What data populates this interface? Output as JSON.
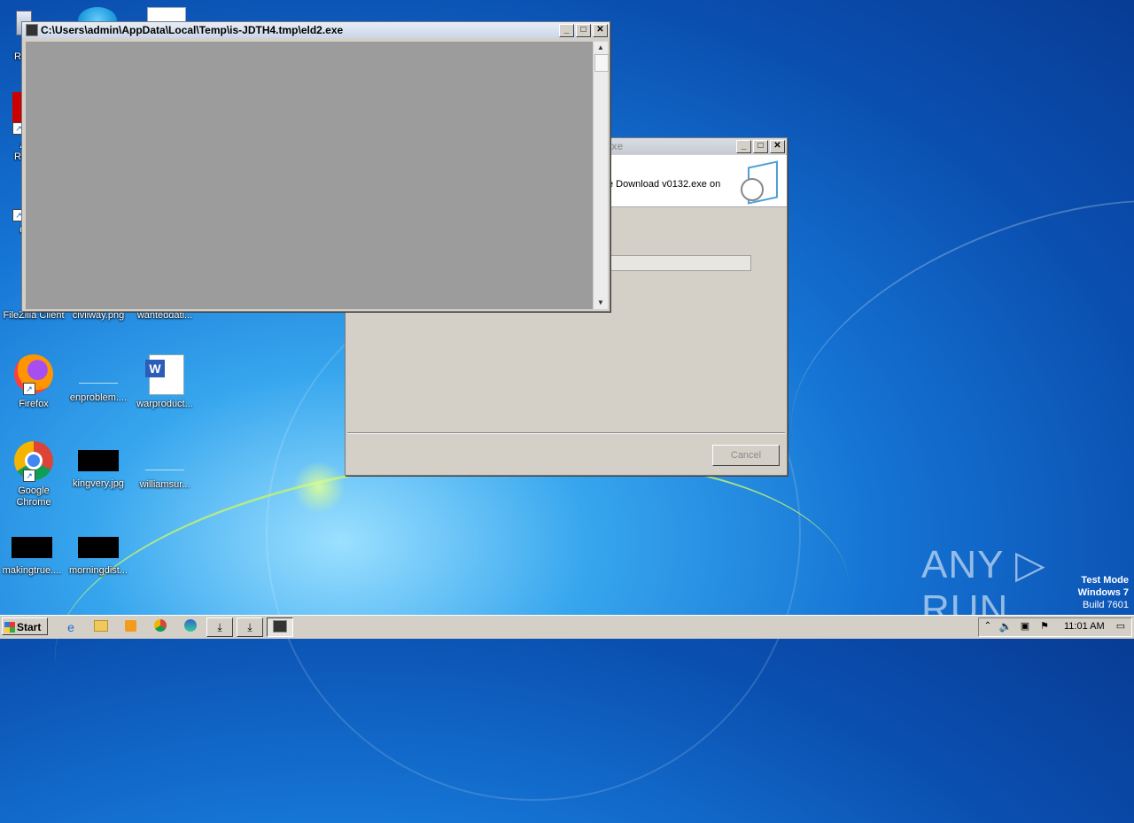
{
  "desktop": {
    "icons": [
      {
        "label": "Re",
        "icon": "recycle-bin-icon"
      },
      {
        "label": "A\nRe",
        "icon": "acrobat-icon"
      },
      {
        "label": "C",
        "icon": "ccleaner-icon"
      },
      {
        "label": "FileZilla Client",
        "icon": "filezilla-icon"
      },
      {
        "label": "civilway.png",
        "icon": "image-file-icon"
      },
      {
        "label": "wanteddati...",
        "icon": "file-icon"
      },
      {
        "label": "Firefox",
        "icon": "firefox-icon"
      },
      {
        "label": "enproblem....",
        "icon": "file-icon"
      },
      {
        "label": "warproduct...",
        "icon": "word-document-icon"
      },
      {
        "label": "Google Chrome",
        "icon": "chrome-icon"
      },
      {
        "label": "kingvery.jpg",
        "icon": "image-file-icon"
      },
      {
        "label": "williamsur...",
        "icon": "file-icon"
      },
      {
        "label": "makingtrue....",
        "icon": "file-icon"
      },
      {
        "label": "morningdist...",
        "icon": "file-icon"
      }
    ]
  },
  "console_window": {
    "title": "C:\\Users\\admin\\AppData\\Local\\Temp\\is-JDTH4.tmp\\eld2.exe",
    "buttons": {
      "minimize": "_",
      "maximize": "□",
      "close": "✕"
    }
  },
  "setup_window": {
    "title": "xe",
    "header_text": "e Download v0132.exe on",
    "cancel_label": "Cancel",
    "buttons": {
      "minimize": "_",
      "maximize": "□",
      "close": "✕"
    }
  },
  "taskbar": {
    "start_label": "Start",
    "clock": "11:01 AM"
  },
  "watermark": {
    "text": "ANY ▷ RUN"
  },
  "test_mode": {
    "line1": "Test Mode",
    "line2": "Windows 7",
    "line3": "Build 7601"
  }
}
